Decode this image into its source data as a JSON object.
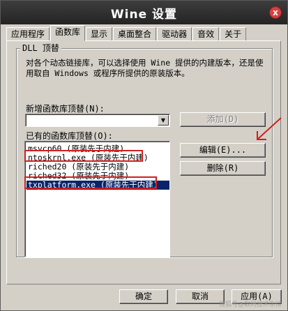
{
  "window": {
    "title": "Wine 设置",
    "close_glyph": "x"
  },
  "tabs": [
    {
      "label": "应用程序",
      "active": false
    },
    {
      "label": "函数库",
      "active": true
    },
    {
      "label": "显示",
      "active": false
    },
    {
      "label": "桌面整合",
      "active": false
    },
    {
      "label": "驱动器",
      "active": false
    },
    {
      "label": "音效",
      "active": false
    },
    {
      "label": "关于",
      "active": false
    }
  ],
  "group": {
    "title": "DLL 顶替",
    "description": "对各个动态链接库，可以选择使用 Wine 提供的内建版本，还是使用取自 Windows 或程序所提供的原装版本。"
  },
  "new_override": {
    "label": "新增函数库顶替(N):",
    "value": "",
    "add_button": "添加(D)"
  },
  "existing": {
    "label": "已有的函数库顶替(O):",
    "items": [
      {
        "text": "msvcp60 (原装先于内建)",
        "selected": false,
        "highlighted": false
      },
      {
        "text": "ntoskrnl.exe (原装先于内建)",
        "selected": false,
        "highlighted": true
      },
      {
        "text": "riched20 (原装先于内建)",
        "selected": false,
        "highlighted": false
      },
      {
        "text": "riched32 (原装先于内建)",
        "selected": false,
        "highlighted": false
      },
      {
        "text": "txplatform.exe (原装先于内建)",
        "selected": true,
        "highlighted": true
      }
    ],
    "edit_button": "编辑(E)...",
    "delete_button": "删除(R)"
  },
  "footer": {
    "ok": "确定",
    "cancel": "取消",
    "apply": "应用(A)"
  },
  "watermark": "搜狐号@数码技术杂烩",
  "colors": {
    "annotation": "#d11f1f",
    "selection": "#0a246a",
    "titlebar": "#2e2e2e"
  }
}
